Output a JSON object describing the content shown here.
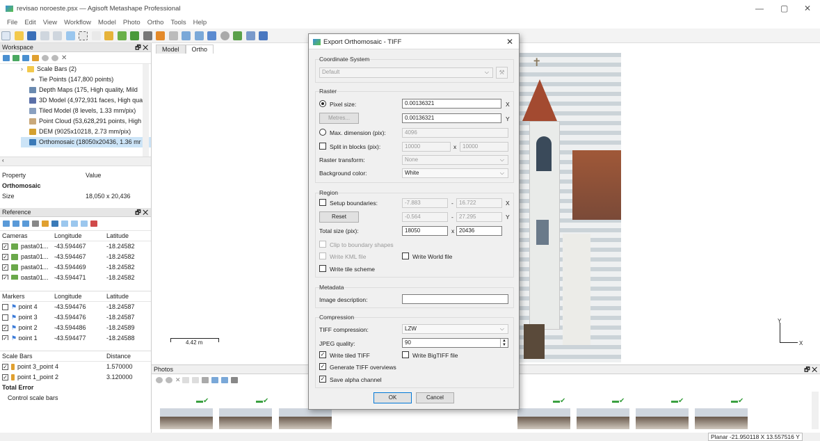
{
  "window": {
    "title": "revisao noroeste.psx — Agisoft Metashape Professional",
    "minimize": "—",
    "maximize": "▢",
    "close": "✕"
  },
  "menu": [
    "File",
    "Edit",
    "View",
    "Workflow",
    "Model",
    "Photo",
    "Ortho",
    "Tools",
    "Help"
  ],
  "workspace": {
    "title": "Workspace",
    "items": [
      {
        "label": "Scale Bars (2)",
        "icon": "folder-icon"
      },
      {
        "label": "Tie Points (147,800 points)",
        "icon": "points-icon"
      },
      {
        "label": "Depth Maps (175, High quality, Mild",
        "icon": "depth-icon"
      },
      {
        "label": "3D Model (4,972,931 faces, High qua",
        "icon": "model-icon"
      },
      {
        "label": "Tiled Model (8 levels, 1.33 mm/pix)",
        "icon": "tiled-icon"
      },
      {
        "label": "Point Cloud (53,628,291 points, High",
        "icon": "cloud-icon"
      },
      {
        "label": "DEM (9025x10218, 2.73 mm/pix)",
        "icon": "dem-icon"
      },
      {
        "label": "Orthomosaic (18050x20436, 1.36 mr",
        "icon": "ortho-icon"
      }
    ]
  },
  "property": {
    "col1": "Property",
    "col2": "Value",
    "section": "Orthomosaic",
    "row_name": "Size",
    "row_value": "18,050 x 20,436"
  },
  "reference": {
    "title": "Reference",
    "cameras": {
      "headers": [
        "Cameras",
        "Longitude",
        "Latitude"
      ],
      "rows": [
        {
          "name": "pasta01...",
          "lon": "-43.594467",
          "lat": "-18.24582"
        },
        {
          "name": "pasta01...",
          "lon": "-43.594467",
          "lat": "-18.24582"
        },
        {
          "name": "pasta01...",
          "lon": "-43.594469",
          "lat": "-18.24582"
        },
        {
          "name": "pasta01...",
          "lon": "-43.594471",
          "lat": "-18.24582"
        }
      ]
    },
    "markers": {
      "headers": [
        "Markers",
        "Longitude",
        "Latitude"
      ],
      "rows": [
        {
          "name": "point 4",
          "lon": "-43.594476",
          "lat": "-18.24587",
          "checked": false
        },
        {
          "name": "point 3",
          "lon": "-43.594476",
          "lat": "-18.24587",
          "checked": false
        },
        {
          "name": "point 2",
          "lon": "-43.594486",
          "lat": "-18.24589",
          "checked": true
        },
        {
          "name": "point 1",
          "lon": "-43.594477",
          "lat": "-18.24588",
          "checked": true
        }
      ]
    },
    "scalebars": {
      "headers": [
        "Scale Bars",
        "Distance"
      ],
      "rows": [
        {
          "name": "point 3_point 4",
          "dist": "1.570000"
        },
        {
          "name": "point 1_point 2",
          "dist": "3.120000"
        }
      ],
      "total": "Total Error",
      "control": "Control scale bars"
    }
  },
  "tabs": [
    "Model",
    "Ortho"
  ],
  "scale_label": "4.42 m",
  "axis": {
    "y": "Y",
    "x": "X"
  },
  "photos": {
    "title": "Photos"
  },
  "status": "Planar  -21.950118 X  13.557516 Y",
  "dialog": {
    "title": "Export Orthomosaic - TIFF",
    "close": "✕",
    "coord_group": "Coordinate System",
    "coord_value": "Default",
    "raster_group": "Raster",
    "pixel_size_label": "Pixel size:",
    "pixel_x": "0.00136321",
    "pixel_y": "0.00136321",
    "x": "X",
    "y": "Y",
    "metres_btn": "Metres...",
    "maxdim_label": "Max. dimension (pix):",
    "maxdim_value": "4096",
    "split_label": "Split in blocks (pix):",
    "split_w": "10000",
    "split_x": "x",
    "split_h": "10000",
    "raster_transform_label": "Raster transform:",
    "raster_transform_value": "None",
    "bg_label": "Background color:",
    "bg_value": "White",
    "region_group": "Region",
    "setup_label": "Setup boundaries:",
    "b1": "-7.883",
    "dash": "-",
    "b2": "16.722",
    "b3": "-0.564",
    "b4": "27.295",
    "reset_btn": "Reset",
    "total_label": "Total size (pix):",
    "total_w": "18050",
    "total_h": "20436",
    "clip_label": "Clip to boundary shapes",
    "kml_label": "Write KML file",
    "world_label": "Write World file",
    "tile_label": "Write tile scheme",
    "meta_group": "Metadata",
    "desc_label": "Image description:",
    "desc_value": "",
    "comp_group": "Compression",
    "tiffcomp_label": "TIFF compression:",
    "tiffcomp_value": "LZW",
    "jpeg_label": "JPEG quality:",
    "jpeg_value": "90",
    "tiled_label": "Write tiled TIFF",
    "bigtiff_label": "Write BigTIFF file",
    "overviews_label": "Generate TIFF overviews",
    "alpha_label": "Save alpha channel",
    "ok": "OK",
    "cancel": "Cancel"
  }
}
